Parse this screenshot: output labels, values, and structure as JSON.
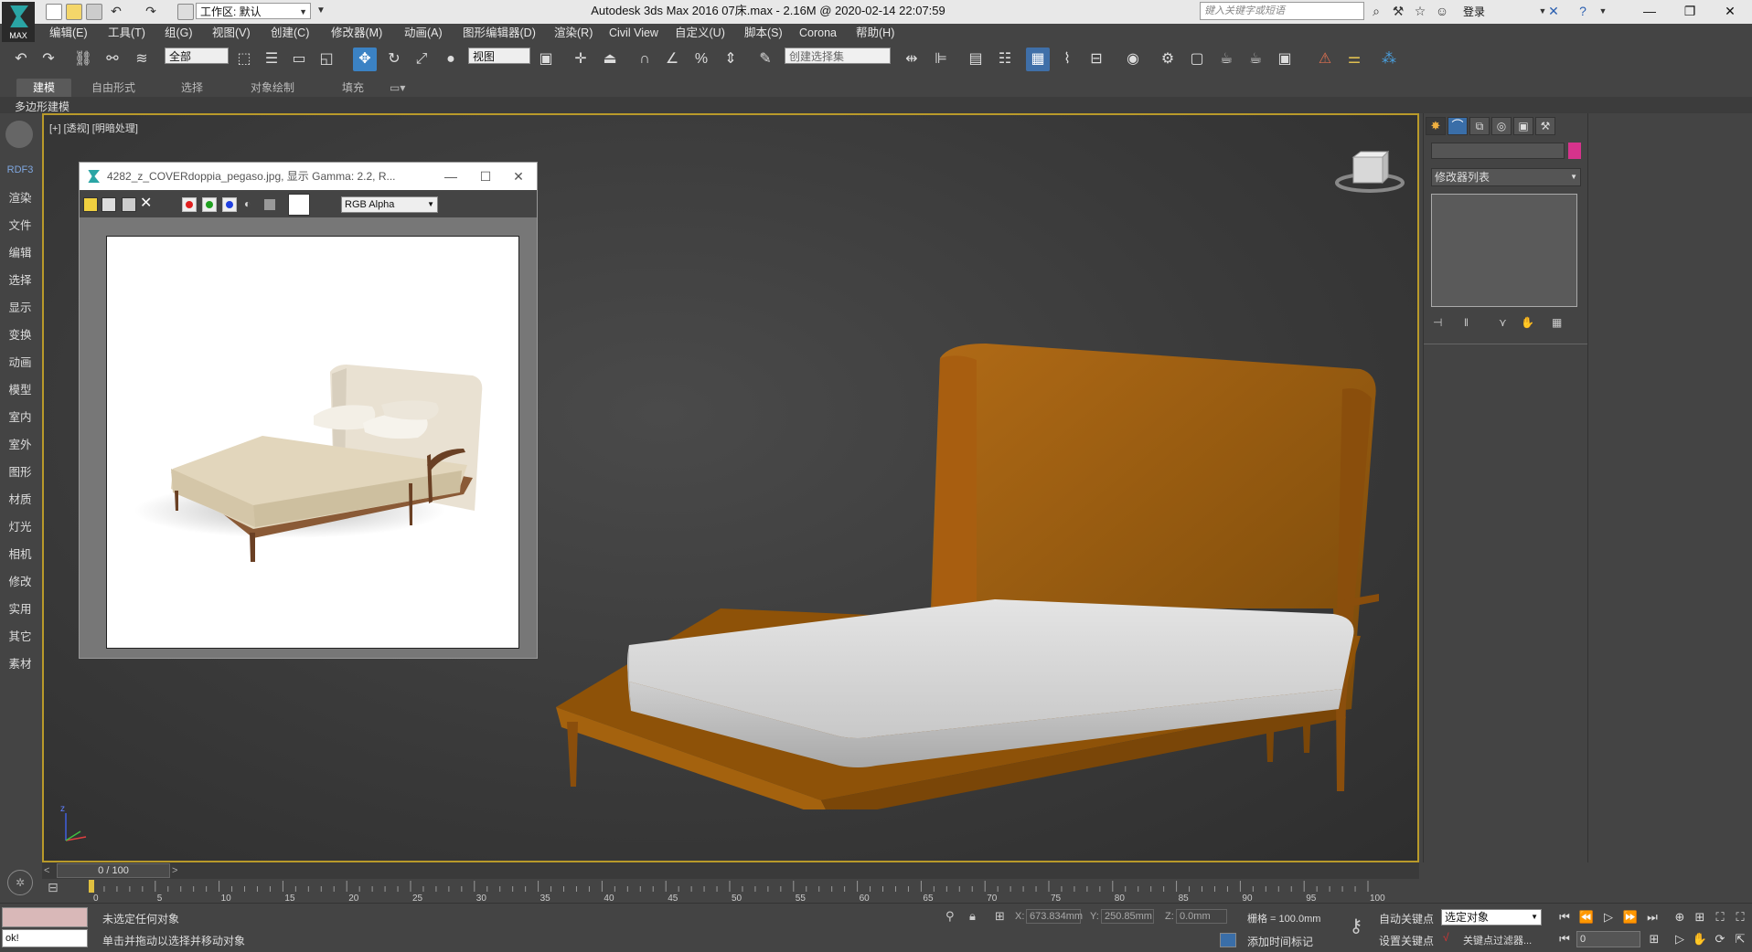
{
  "titlebar": {
    "logo_text": "MAX",
    "workspace": "工作区: 默认",
    "app_title": "Autodesk 3ds Max 2016     07床.max - 2.16M @ 2020-02-14 22:07:59",
    "search_placeholder": "键入关键字或短语",
    "login": "登录"
  },
  "menubar": [
    "编辑(E)",
    "工具(T)",
    "组(G)",
    "视图(V)",
    "创建(C)",
    "修改器(M)",
    "动画(A)",
    "图形编辑器(D)",
    "渲染(R)",
    "Civil View",
    "自定义(U)",
    "脚本(S)",
    "Corona",
    "帮助(H)"
  ],
  "toolbar": {
    "selection_filter": "全部",
    "ref_coord": "视图",
    "named_selection": "创建选择集"
  },
  "ribbon": {
    "tabs": [
      "建模",
      "自由形式",
      "选择",
      "对象绘制",
      "填充"
    ],
    "sub_label": "多边形建模"
  },
  "leftpanel": {
    "header": "RDF3",
    "items": [
      "渲染",
      "文件",
      "编辑",
      "选择",
      "显示",
      "变换",
      "动画",
      "模型",
      "室内",
      "室外",
      "图形",
      "材质",
      "灯光",
      "相机",
      "修改",
      "实用",
      "其它",
      "素材"
    ]
  },
  "viewport": {
    "label": "[+] [透视] [明暗处理]",
    "axis_x": "x",
    "axis_y": "y",
    "axis_z": "z"
  },
  "image_window": {
    "title": "4282_z_COVERdoppia_pegaso.jpg, 显示 Gamma: 2.2, R...",
    "channel_select": "RGB Alpha"
  },
  "command_panel": {
    "modifier_list": "修改器列表"
  },
  "timeline": {
    "frame_display": "0 / 100",
    "ticks": [
      "0",
      "5",
      "10",
      "15",
      "20",
      "25",
      "30",
      "35",
      "40",
      "45",
      "50",
      "55",
      "60",
      "65",
      "70",
      "75",
      "80",
      "85",
      "90",
      "95",
      "100"
    ]
  },
  "status": {
    "maxscript_input": "ok!",
    "selection_msg": "未选定任何对象",
    "prompt_msg": "单击并拖动以选择并移动对象",
    "x_label": "X:",
    "x_value": "673.834mm",
    "y_label": "Y:",
    "y_value": "250.85mm",
    "z_label": "Z:",
    "z_value": "0.0mm",
    "grid": "栅格 = 100.0mm",
    "add_time_tag": "添加时间标记",
    "auto_key": "自动关键点",
    "set_key": "设置关键点",
    "key_filter_select": "选定对象",
    "key_filters": "关键点过滤器...",
    "frame_input": "0"
  }
}
